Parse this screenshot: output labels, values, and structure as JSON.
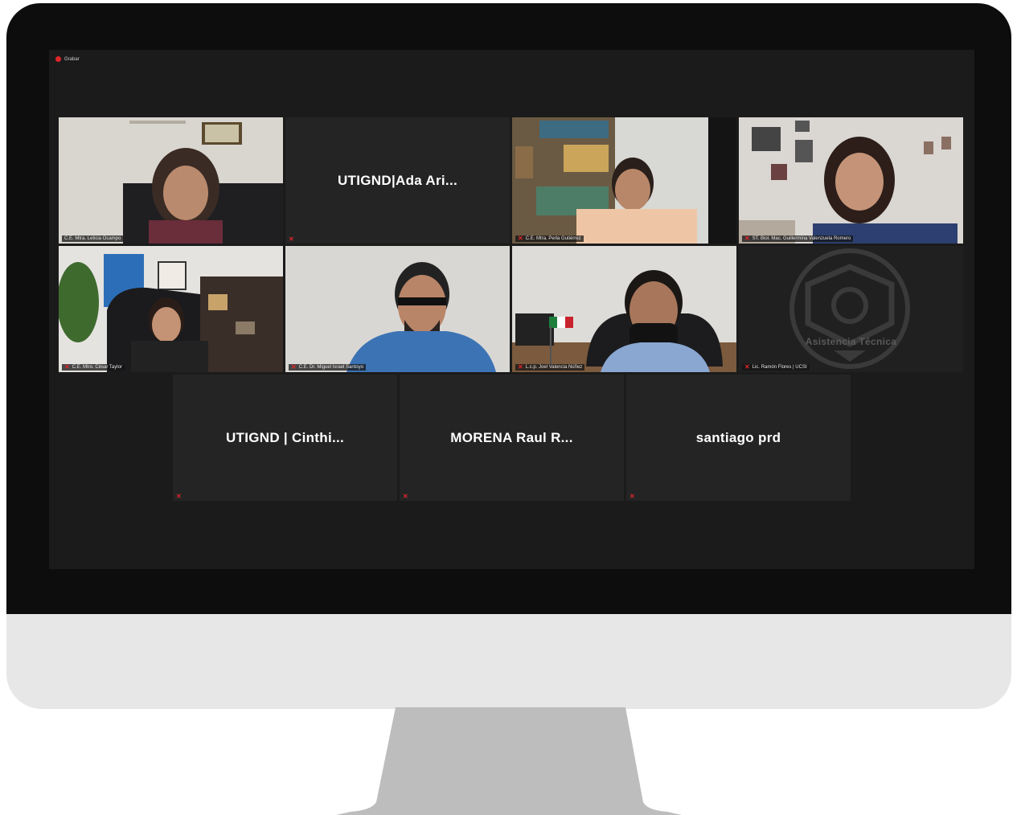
{
  "recording": {
    "label": "Grabar"
  },
  "participants_row1": [
    {
      "label": "C.E. Mtra. Leticia Ocampo",
      "video": true,
      "active": true,
      "muted": false
    },
    {
      "name": "UTIGND|Ada Ari...",
      "video": false,
      "muted": true
    },
    {
      "label": "C.E. Mtra. Perla Gutiérrez",
      "video": true,
      "muted": true
    },
    {
      "label": "ST. Biol. Mac. Guillermina Valenzuela Romero",
      "video": true,
      "muted": true
    }
  ],
  "participants_row2": [
    {
      "label": "C.E. Mtro. César Taylor",
      "video": true,
      "muted": true
    },
    {
      "label": "C.E. Dr. Miguel Israel Santoyo",
      "video": true,
      "muted": true
    },
    {
      "label": "L.c.p. Joel Valencia Núñez",
      "video": true,
      "muted": true
    },
    {
      "label": "Lic. Ramón Flores | UCSI",
      "watermark": "Asistencia Técnica",
      "video": true,
      "muted": true
    }
  ],
  "participants_row3": [
    {
      "name": "UTIGND | Cinthi...",
      "muted": true
    },
    {
      "name": "MORENA Raul R...",
      "muted": true
    },
    {
      "name": "santiago prd",
      "muted": true
    }
  ],
  "colors": {
    "active_border": "#b8d43a",
    "mute": "#e0262a",
    "tile_bg": "#242424",
    "screen_bg": "#1b1b1b"
  }
}
